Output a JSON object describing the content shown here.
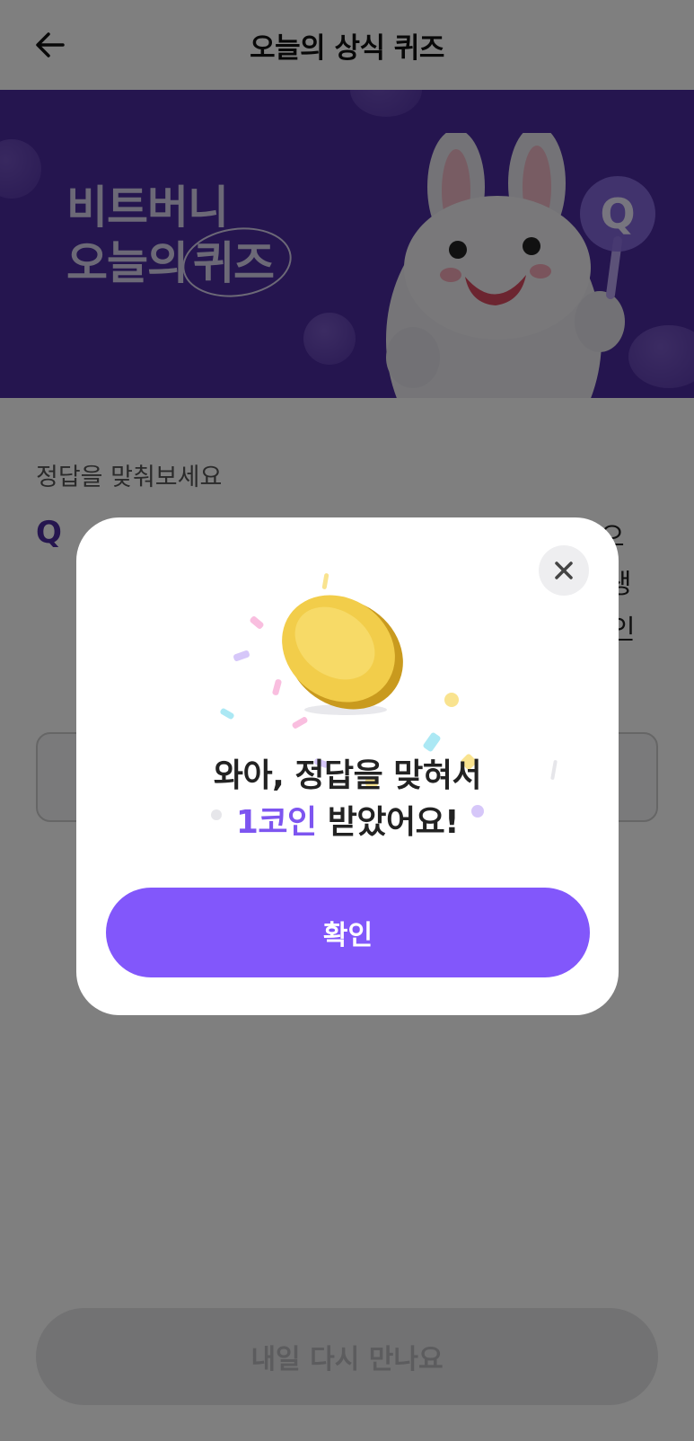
{
  "header": {
    "title": "오늘의 상식 퀴즈",
    "back_icon": "arrow-left-icon"
  },
  "banner": {
    "title_line1": "비트버니",
    "title_line2_prefix": "오늘의",
    "title_line2_highlight": "퀴즈",
    "background_color": "#4b2a9e",
    "mascot": "bunny-mascot-icon",
    "mascot_sign": "Q"
  },
  "quiz": {
    "hint": "정답을 맞춰보세요",
    "question_marker": "Q",
    "question_fragments": [
      "으",
      "생",
      "인"
    ],
    "bottom_button_label": "내일 다시 만나요"
  },
  "modal": {
    "close_icon": "close-icon",
    "coin_icon": "gold-coin-icon",
    "message_line1": "와아, 정답을 맞혀서",
    "message_accent": "1코인",
    "message_line2_rest": " 받았어요!",
    "confirm_label": "확인",
    "accent_color": "#8257fb"
  }
}
